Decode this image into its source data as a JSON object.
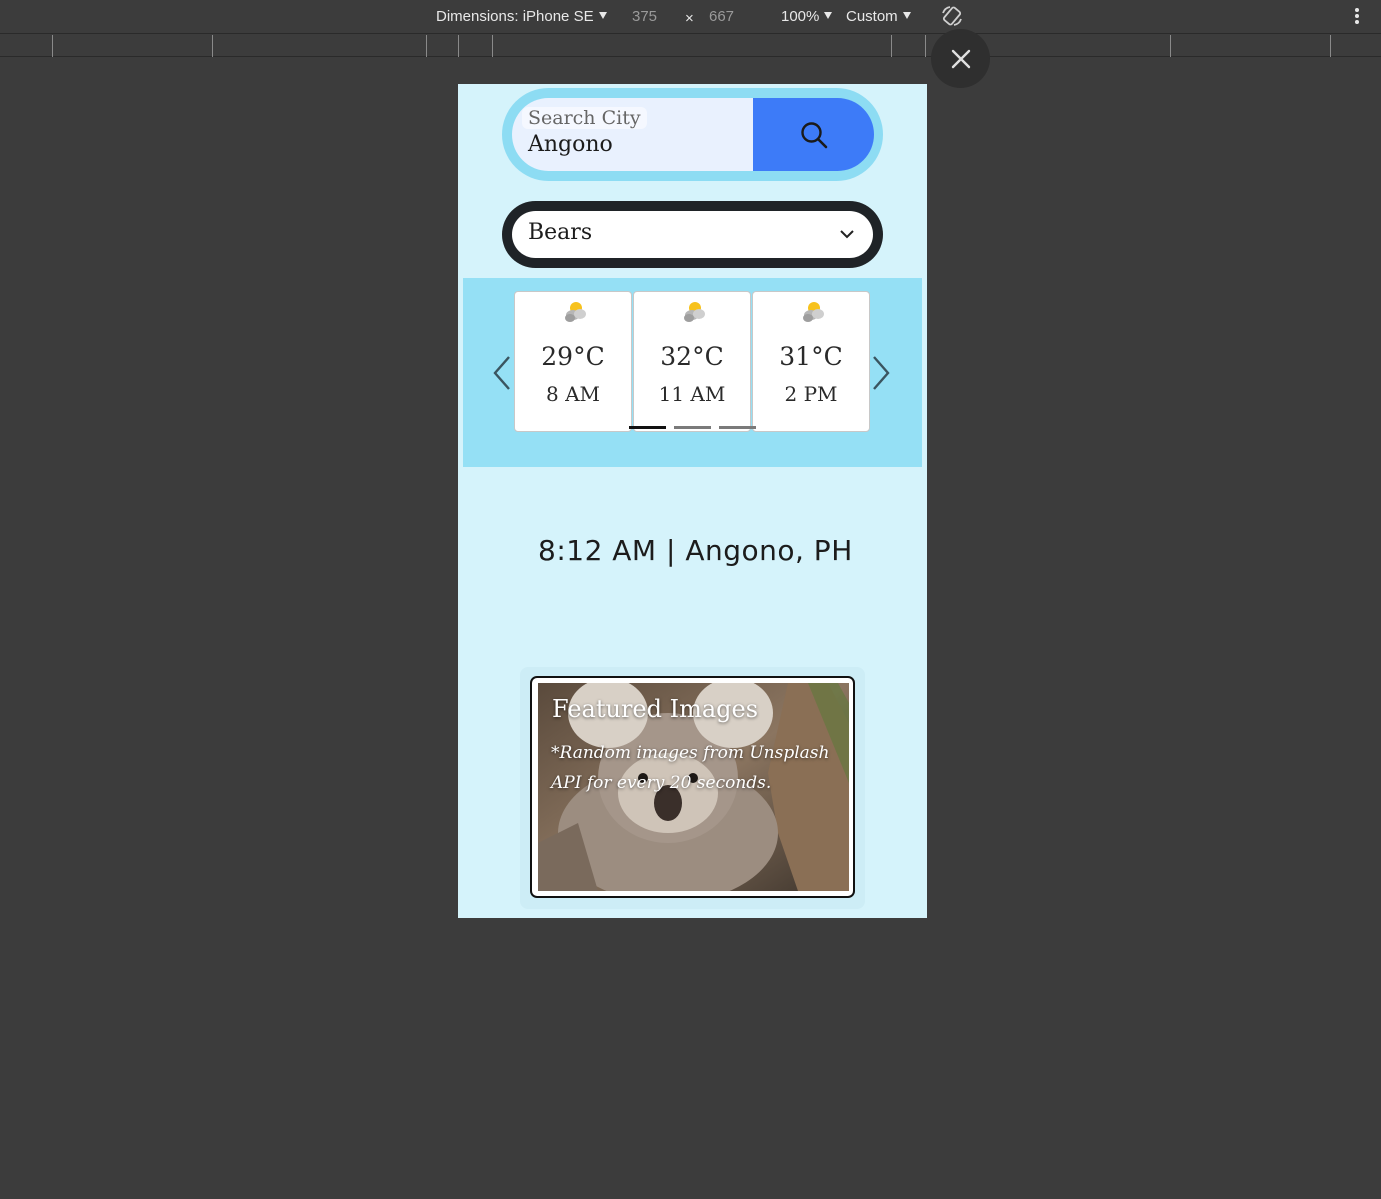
{
  "devtools": {
    "dimensions_label": "Dimensions: iPhone SE",
    "width": "375",
    "times": "×",
    "height": "667",
    "zoom": "100%",
    "throttle": "Custom"
  },
  "search": {
    "label": "Search City",
    "value": "Angono"
  },
  "category": {
    "selected": "Bears"
  },
  "forecast": {
    "cards": [
      {
        "temp": "29°C",
        "time": "8 AM",
        "icon": "partly-cloudy-icon"
      },
      {
        "temp": "32°C",
        "time": "11 AM",
        "icon": "partly-cloudy-icon"
      },
      {
        "temp": "31°C",
        "time": "2 PM",
        "icon": "partly-cloudy-icon"
      }
    ],
    "active_page": 1,
    "page_count": 3
  },
  "datetime": "8:12 AM | Angono, PH",
  "featured": {
    "title": "Featured Images",
    "note": "*Random images from Unsplash API for every 20 seconds."
  },
  "colors": {
    "page_bg": "#d5f3fb",
    "search_button": "#3d7bf8",
    "forecast_bg": "#95e0f5"
  }
}
